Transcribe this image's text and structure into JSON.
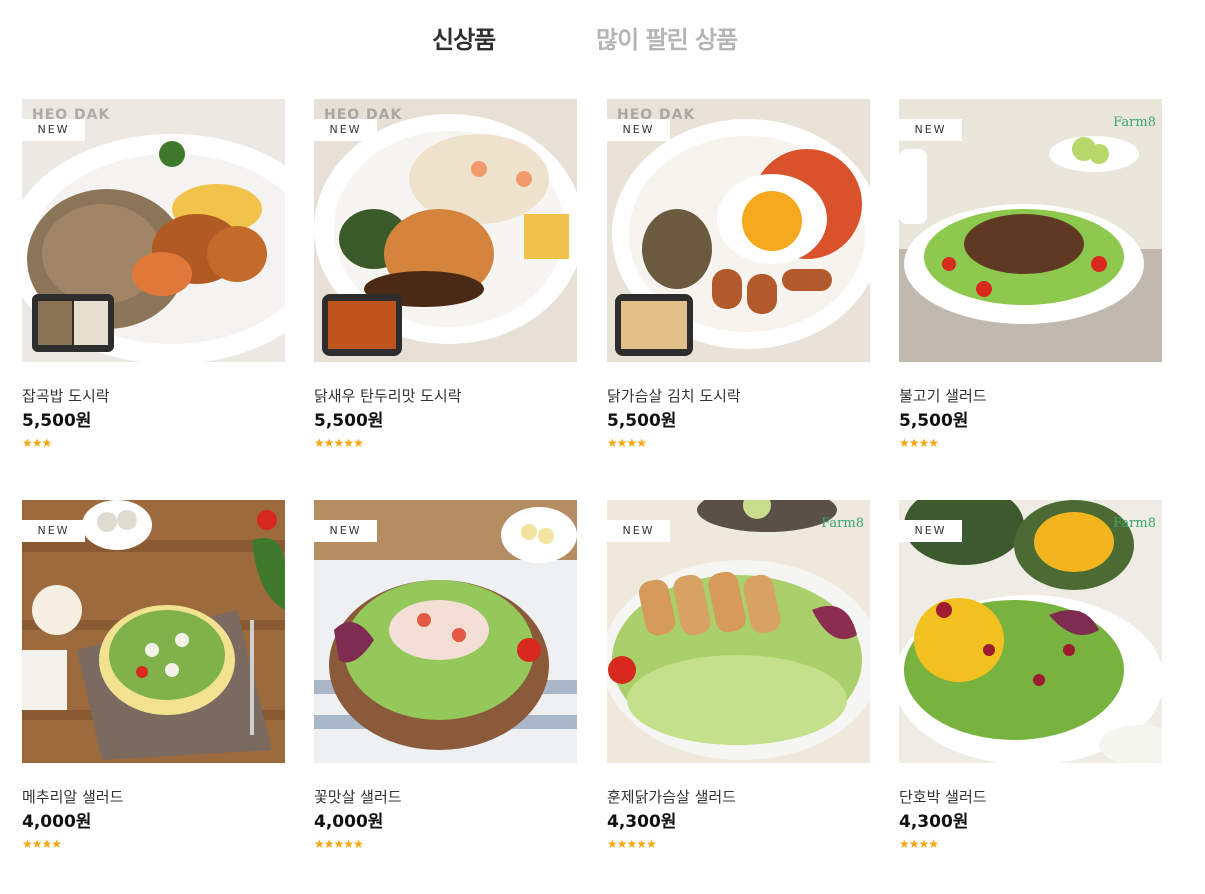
{
  "tabs": [
    {
      "label": "신상품",
      "active": true
    },
    {
      "label": "많이 팔린 상품",
      "active": false
    }
  ],
  "badge_label": "NEW",
  "brand_farm8": "Farm8",
  "brand_heo": "HEO DAK",
  "star_color": "#f3a712",
  "products": [
    {
      "name": "잡곡밥 도시락",
      "price": "5,500원",
      "rating": 3,
      "image_icon": "grain-rice-lunchbox-image"
    },
    {
      "name": "닭새우 탄두리맛 도시락",
      "price": "5,500원",
      "rating": 5,
      "image_icon": "chicken-shrimp-tandoori-lunchbox-image"
    },
    {
      "name": "닭가슴살 김치 도시락",
      "price": "5,500원",
      "rating": 4,
      "image_icon": "chicken-kimchi-lunchbox-image"
    },
    {
      "name": "불고기 샐러드",
      "price": "5,500원",
      "rating": 4,
      "image_icon": "bulgogi-salad-image"
    },
    {
      "name": "메추리알 샐러드",
      "price": "4,000원",
      "rating": 4,
      "image_icon": "quail-egg-salad-image"
    },
    {
      "name": "꽃맛살 샐러드",
      "price": "4,000원",
      "rating": 5,
      "image_icon": "crab-stick-salad-image"
    },
    {
      "name": "훈제닭가슴살 샐러드",
      "price": "4,300원",
      "rating": 5,
      "image_icon": "smoked-chicken-salad-image"
    },
    {
      "name": "단호박 샐러드",
      "price": "4,300원",
      "rating": 4,
      "image_icon": "sweet-pumpkin-salad-image"
    }
  ]
}
